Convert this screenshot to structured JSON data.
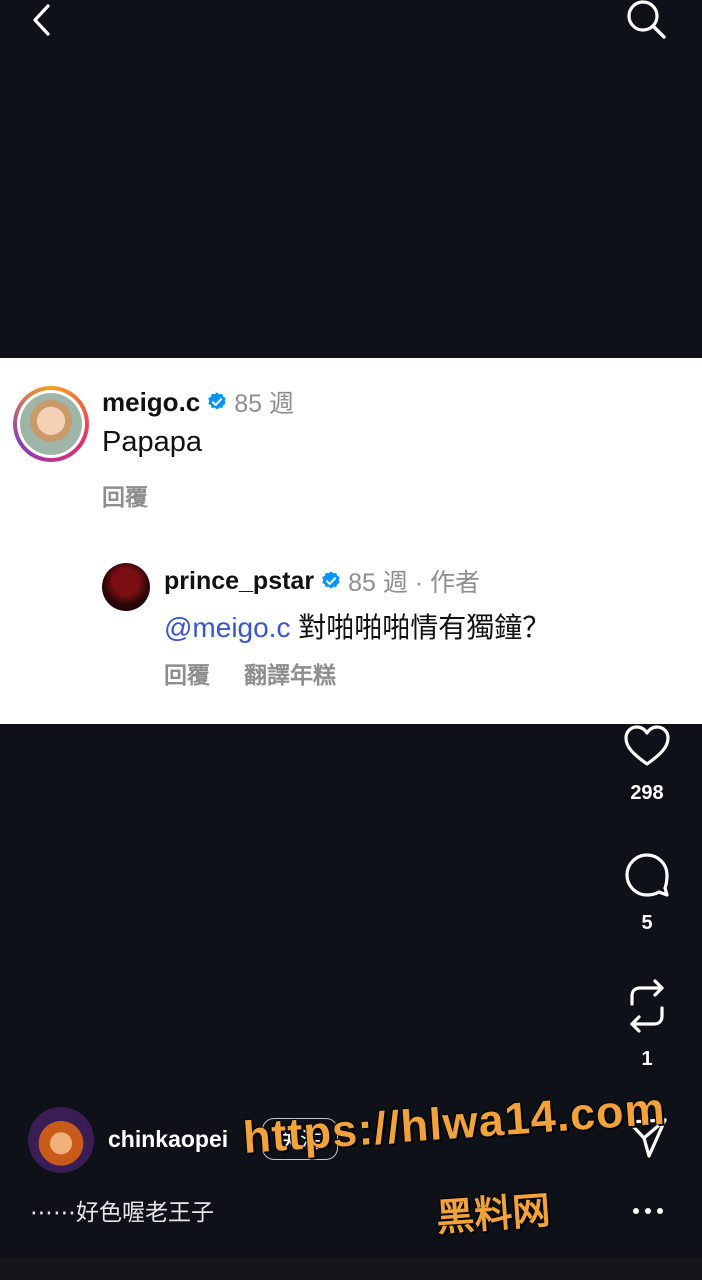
{
  "comment": {
    "username": "meigo.c",
    "time": "85 週",
    "text": "Papapa",
    "reply_label": "回覆"
  },
  "reply": {
    "username": "prince_pstar",
    "meta": "85 週 · 作者",
    "mention": "@meigo.c",
    "text": " 對啪啪啪情有獨鐘？",
    "reply_label": "回覆",
    "translate_label": "翻譯年糕"
  },
  "actions": {
    "likes": "298",
    "comments": "5",
    "reposts": "1"
  },
  "author": {
    "username": "chinkaopei",
    "follow_label": "关注",
    "caption": "⋯⋯好色喔老王子"
  },
  "watermark": {
    "line1": "https://hlwa14.com",
    "line2": "黑料网"
  },
  "colors": {
    "background": "#0e1117",
    "verified": "#0095f6",
    "mention": "#3a55c9",
    "watermark": "#f2a23a"
  }
}
